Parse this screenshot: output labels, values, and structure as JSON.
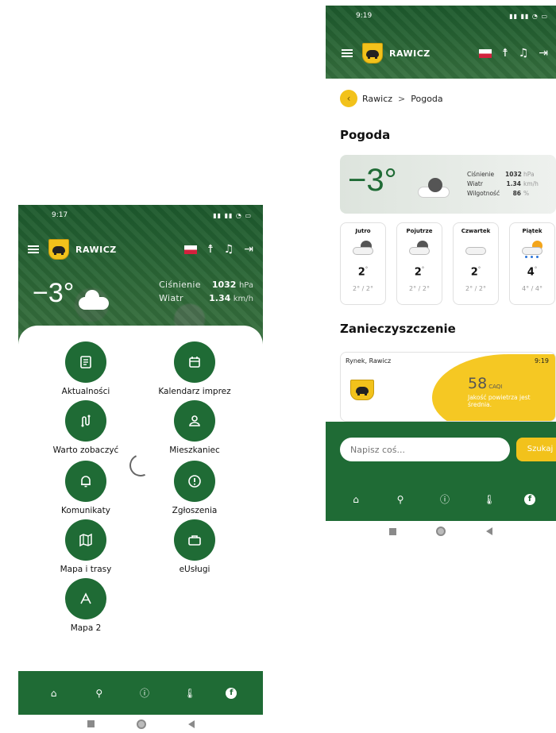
{
  "left": {
    "status_time": "9:17",
    "city": "RAWICZ",
    "temperature": "−3°",
    "stats": [
      {
        "label": "Ciśnienie",
        "value": "1032",
        "unit": "hPa"
      },
      {
        "label": "Wiatr",
        "value": "1.34",
        "unit": "km/h"
      }
    ],
    "tiles": [
      {
        "label": "Aktualności",
        "icon": "news-icon"
      },
      {
        "label": "Kalendarz imprez",
        "icon": "calendar-icon"
      },
      {
        "label": "Warto zobaczyć",
        "icon": "route-icon"
      },
      {
        "label": "Mieszkaniec",
        "icon": "person-icon"
      },
      {
        "label": "Komunikaty",
        "icon": "bell-icon"
      },
      {
        "label": "Zgłoszenia",
        "icon": "alert-icon"
      },
      {
        "label": "Mapa i trasy",
        "icon": "map-icon"
      },
      {
        "label": "eUsługi",
        "icon": "briefcase-icon"
      },
      {
        "label": "Mapa 2",
        "icon": "triangle-icon"
      }
    ]
  },
  "right": {
    "status_time": "9:19",
    "city": "RAWICZ",
    "breadcrumb": {
      "home": "Rawicz",
      "sep": ">",
      "current": "Pogoda"
    },
    "weather_title": "Pogoda",
    "temperature": "−3°",
    "stats": [
      {
        "label": "Ciśnienie",
        "value": "1032",
        "unit": "hPa"
      },
      {
        "label": "Wiatr",
        "value": "1.34",
        "unit": "km/h"
      },
      {
        "label": "Wilgotność",
        "value": "86",
        "unit": "%"
      }
    ],
    "forecast": [
      {
        "day": "Jutro",
        "temp": "2",
        "minmax": "2° / 2°",
        "icon": "cloud-dark"
      },
      {
        "day": "Pojutrze",
        "temp": "2",
        "minmax": "2° / 2°",
        "icon": "cloud-dark"
      },
      {
        "day": "Czwartek",
        "temp": "2",
        "minmax": "2° / 2°",
        "icon": "cloud"
      },
      {
        "day": "Piątek",
        "temp": "4",
        "minmax": "4° / 4°",
        "icon": "sun-rain"
      }
    ],
    "pollution_title": "Zanieczyszczenie",
    "pollution": {
      "location": "Rynek, Rawicz",
      "time": "9:19",
      "value": "58",
      "unit": "CAQI",
      "description": "Jakość powietrza jest średnia."
    },
    "input_placeholder": "Napisz coś...",
    "search_label": "Szukaj"
  },
  "nav": [
    "home-icon",
    "search-icon",
    "info-icon",
    "thermometer-icon",
    "facebook-icon"
  ],
  "colors": {
    "primary_green": "#1f6b35",
    "accent_yellow": "#f2c21b"
  }
}
